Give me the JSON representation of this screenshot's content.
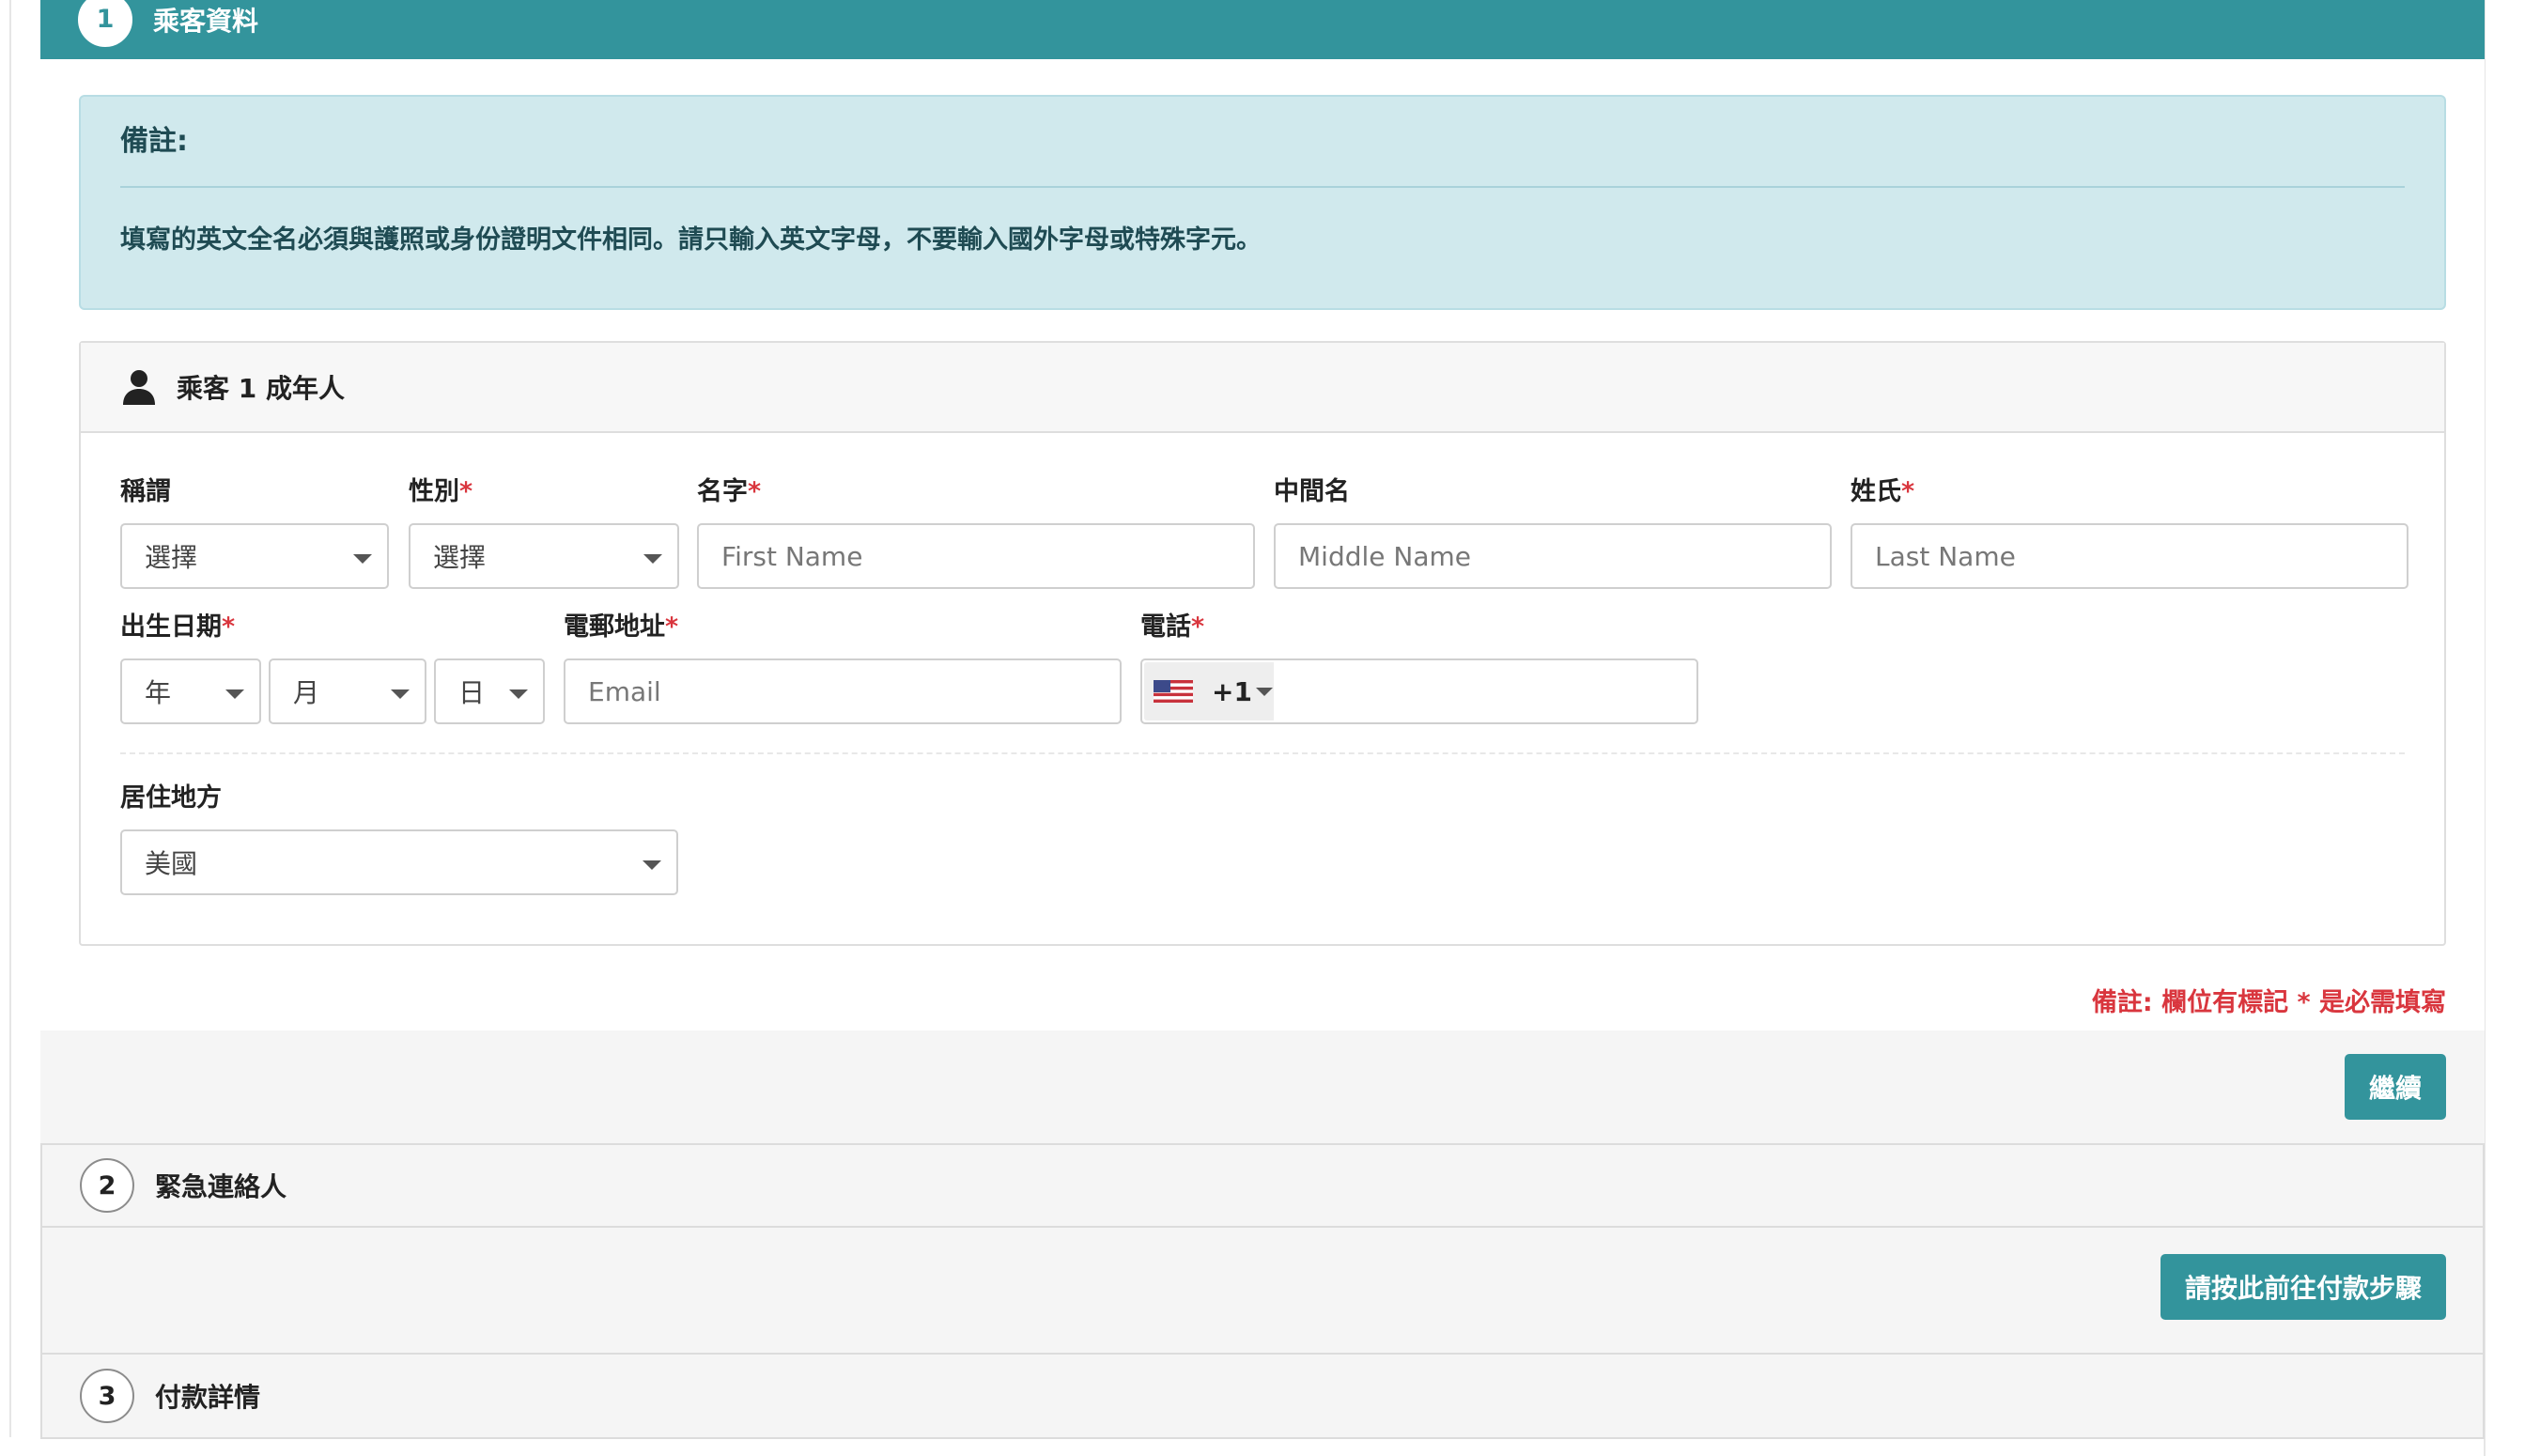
{
  "steps": [
    {
      "number": "1",
      "title": "乘客資料"
    },
    {
      "number": "2",
      "title": "緊急連絡人"
    },
    {
      "number": "3",
      "title": "付款詳情"
    }
  ],
  "note": {
    "title": "備註:",
    "text": "填寫的英文全名必須與護照或身份證明文件相同。請只輸入英文字母，不要輸入國外字母或特殊字元。"
  },
  "passenger": {
    "title": "乘客 1 成年人",
    "salutation": {
      "label": "稱謂",
      "value": "選擇"
    },
    "gender": {
      "label": "性別",
      "value": "選擇"
    },
    "first_name": {
      "label": "名字",
      "placeholder": "First Name"
    },
    "middle_name": {
      "label": "中間名",
      "placeholder": "Middle Name"
    },
    "last_name": {
      "label": "姓氏",
      "placeholder": "Last Name"
    },
    "dob": {
      "label": "出生日期",
      "year": "年",
      "month": "月",
      "day": "日"
    },
    "email": {
      "label": "電郵地址",
      "placeholder": "Email"
    },
    "phone": {
      "label": "電話",
      "dial_code": "+1",
      "value": ""
    },
    "residence": {
      "label": "居住地方",
      "value": "美國"
    },
    "required_mark": "*"
  },
  "required_note": "備註: 欄位有標記 * 是必需填寫",
  "buttons": {
    "continue": "繼續",
    "payment": "請按此前往付款步驟"
  },
  "colors": {
    "primary": "#33949c",
    "note_bg": "#d0e9ed",
    "required": "#d9363e"
  }
}
